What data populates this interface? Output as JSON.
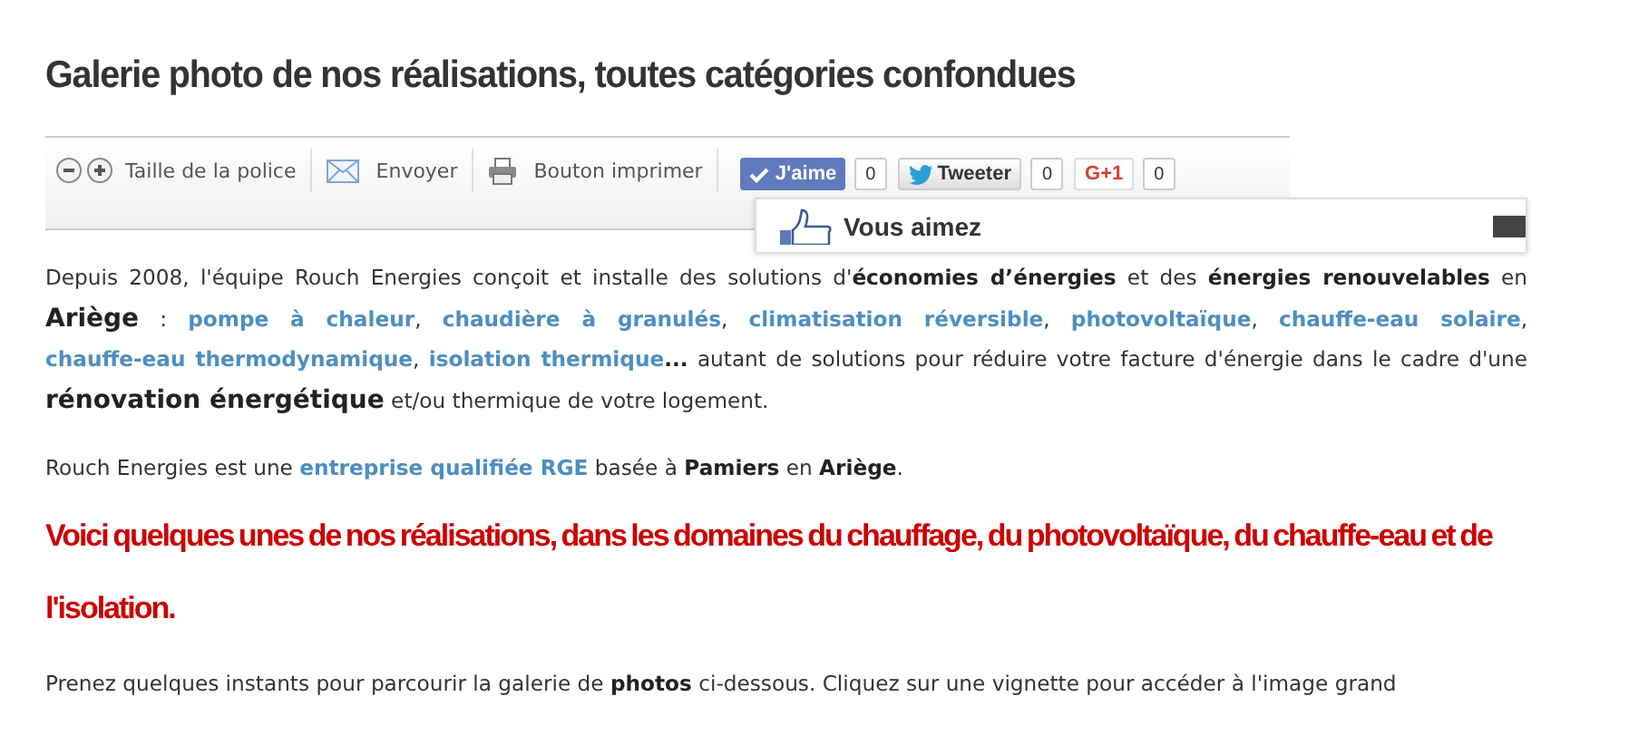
{
  "title": "Galerie photo de nos réalisations, toutes catégories confondues",
  "toolbar": {
    "font_size_label": "Taille de la police",
    "send_label": "Envoyer",
    "print_label": "Bouton imprimer",
    "social": [
      {
        "kind": "like",
        "label": "J'aime",
        "count": "0"
      },
      {
        "kind": "tweet",
        "label": "Tweeter",
        "count": "0"
      },
      {
        "kind": "gplus",
        "label": "G+1",
        "count": "0"
      }
    ],
    "popup": {
      "text": "Vous aimez"
    }
  },
  "paragraphs": [
    [
      {
        "kind": "plain",
        "text": "Depuis 2008, l'équipe Rouch Energies conçoit et installe des solutions d'"
      },
      {
        "kind": "bold",
        "text": "économies d’énergies"
      },
      {
        "kind": "plain",
        "text": " et des "
      },
      {
        "kind": "bold",
        "text": "énergies renouvelables"
      },
      {
        "kind": "plain",
        "text": " en "
      },
      {
        "kind": "big",
        "text": "Ariège"
      },
      {
        "kind": "plain",
        "text": " : "
      },
      {
        "kind": "link",
        "text": "pompe à chaleur"
      },
      {
        "kind": "plain",
        "text": ", "
      },
      {
        "kind": "link",
        "text": "chaudière à granulés"
      },
      {
        "kind": "plain",
        "text": ", "
      },
      {
        "kind": "link",
        "text": "climatisation réversible"
      },
      {
        "kind": "plain",
        "text": ", "
      },
      {
        "kind": "link",
        "text": "photovoltaïque"
      },
      {
        "kind": "plain",
        "text": ", "
      },
      {
        "kind": "link",
        "text": "chauffe-eau solaire"
      },
      {
        "kind": "plain",
        "text": ", "
      },
      {
        "kind": "link",
        "text": "chauffe-eau thermodynamique"
      },
      {
        "kind": "plain",
        "text": ", "
      },
      {
        "kind": "link",
        "text": "isolation thermique"
      },
      {
        "kind": "bold",
        "text": "..."
      },
      {
        "kind": "plain",
        "text": " autant de solutions pour réduire votre facture d'énergie dans le cadre d'une "
      },
      {
        "kind": "big",
        "text": "rénovation énergétique"
      },
      {
        "kind": "plain",
        "text": " et/ou thermique de votre logement."
      }
    ],
    [
      {
        "kind": "plain",
        "text": "Rouch Energies est une "
      },
      {
        "kind": "link",
        "text": "entreprise qualifiée RGE"
      },
      {
        "kind": "plain",
        "text": " basée à "
      },
      {
        "kind": "bold",
        "text": "Pamiers"
      },
      {
        "kind": "plain",
        "text": " en "
      },
      {
        "kind": "bold",
        "text": "Ariège"
      },
      {
        "kind": "plain",
        "text": "."
      }
    ]
  ],
  "highlight": "Voici quelques unes de nos réalisations, dans les domaines du chauffage, du photovoltaïque, du chauffe-eau et de l'isolation.",
  "intro": [
    {
      "kind": "plain",
      "text": "Prenez quelques instants pour parcourir la galerie de "
    },
    {
      "kind": "bold",
      "text": "photos"
    },
    {
      "kind": "plain",
      "text": " ci-dessous. Cliquez sur une vignette pour accéder à l'image grand"
    }
  ]
}
